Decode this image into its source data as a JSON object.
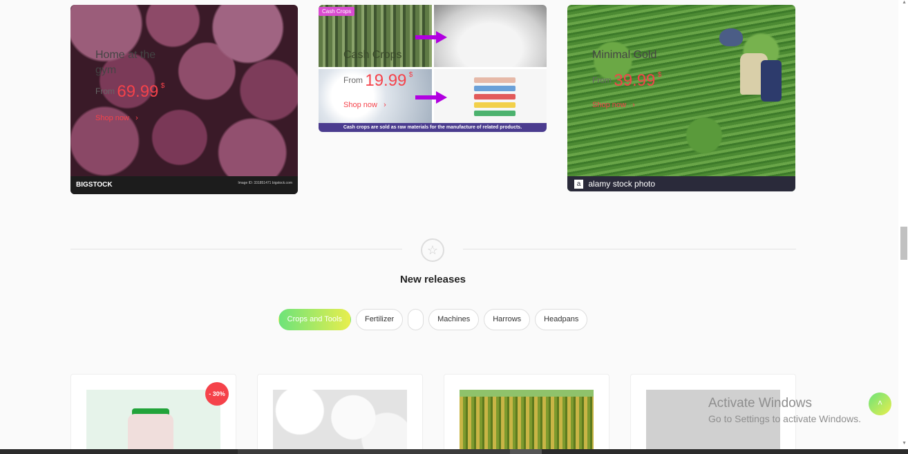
{
  "promos": [
    {
      "title": "Home at the gym",
      "from_label": "From",
      "price": "69.99",
      "currency": "$",
      "shop_label": "Shop now",
      "image_watermark": "BIGSTOCK",
      "image_note": "Image ID: 331851471 bigstock.com"
    },
    {
      "badge": "Cash Crops",
      "title": "Cash Crops",
      "from_label": "From",
      "price": "19.99",
      "currency": "$",
      "shop_label": "Shop now",
      "caption": "Cash crops are sold as raw materials for the manufacture of related products."
    },
    {
      "title": "Minimal Gold",
      "from_label": "From",
      "price": "39.99",
      "currency": "$",
      "shop_label": "Shop now",
      "image_watermark": "alamy stock photo"
    }
  ],
  "section": {
    "title": "New releases",
    "icon": "star-icon"
  },
  "tabs": [
    {
      "label": "Crops and Tools",
      "active": true
    },
    {
      "label": "Fertilizer"
    },
    {
      "label": ""
    },
    {
      "label": "Machines"
    },
    {
      "label": "Harrows"
    },
    {
      "label": "Headpans"
    }
  ],
  "products": [
    {
      "discount": "- 30%",
      "image": "fertilizer-bottle"
    },
    {
      "image": "cotton"
    },
    {
      "image": "cornfield"
    },
    {
      "image": "placeholder"
    }
  ],
  "watermark": {
    "title": "Activate Windows",
    "subtitle": "Go to Settings to activate Windows."
  },
  "colors": {
    "accent": "#f5424a",
    "gradient_start": "#6de37a",
    "gradient_end": "#e8ee4d"
  }
}
